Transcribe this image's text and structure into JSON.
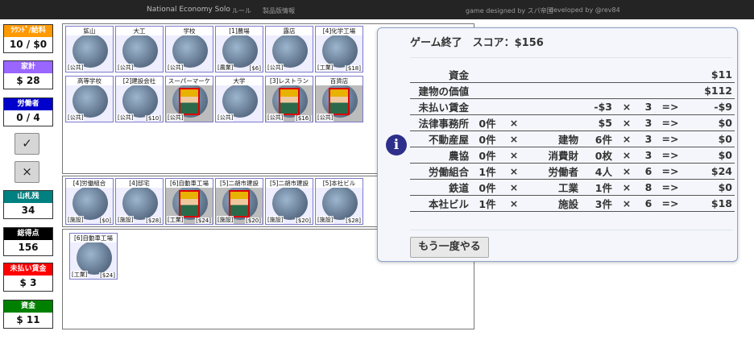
{
  "topbar": {
    "title": "National Economy Solo",
    "nav_rules": "ルール",
    "nav_cards": "製品版情報",
    "credit_design": "game designed by スパ帝国",
    "credit_dev": "developed by @rev84"
  },
  "stats": [
    {
      "label": "ﾗｳﾝﾄﾞ/給料",
      "value": "10 / $0",
      "color": "#ff9900"
    },
    {
      "label": "家計",
      "value": "$ 28",
      "color": "#9966ff"
    },
    {
      "label": "労働者",
      "value": "0 / 4",
      "color": "#0000cc"
    },
    {
      "label": "山札残",
      "value": "34",
      "color": "#008080"
    },
    {
      "label": "総得点",
      "value": "156",
      "color": "#000000"
    },
    {
      "label": "未払い賃金",
      "value": "$ 3",
      "color": "#ff0000"
    },
    {
      "label": "資金",
      "value": "$ 11",
      "color": "#008000"
    }
  ],
  "buttons": {
    "confirm": "✓",
    "cancel": "×"
  },
  "public_cards": [
    {
      "name": "鉱山",
      "cat": "[公共]",
      "cost": "",
      "worked": false
    },
    {
      "name": "大工",
      "cat": "[公共]",
      "cost": "",
      "worked": false
    },
    {
      "name": "学校",
      "cat": "[公共]",
      "cost": "",
      "worked": false
    },
    {
      "name": "[1]農場",
      "cat": "[農業]",
      "cost": "[$6]",
      "worked": false
    },
    {
      "name": "露店",
      "cat": "[公共]",
      "cost": "",
      "worked": false
    },
    {
      "name": "[4]化学工場",
      "cat": "[工業]",
      "cost": "[$18]",
      "worked": false
    },
    {
      "name": "高等学校",
      "cat": "[公共]",
      "cost": "",
      "worked": false
    },
    {
      "name": "[2]建設会社",
      "cat": "[公共]",
      "cost": "[$10]",
      "worked": false
    },
    {
      "name": "スーパーマーケ",
      "cat": "[公共]",
      "cost": "",
      "worked": true
    },
    {
      "name": "大学",
      "cat": "[公共]",
      "cost": "",
      "worked": false
    },
    {
      "name": "[3]レストラン",
      "cat": "[公共]",
      "cost": "[$16]",
      "worked": true
    },
    {
      "name": "百貨店",
      "cat": "[公共]",
      "cost": "",
      "worked": true
    }
  ],
  "owned_cards": [
    {
      "name": "[4]労働組合",
      "cat": "[施設]",
      "cost": "[$0]",
      "worked": false
    },
    {
      "name": "[4]邸宅",
      "cat": "[施設]",
      "cost": "[$28]",
      "worked": false
    },
    {
      "name": "[6]自動車工場",
      "cat": "[工業]",
      "cost": "[$24]",
      "worked": true
    },
    {
      "name": "[5]二胡市建設",
      "cat": "[施設]",
      "cost": "[$20]",
      "worked": true
    },
    {
      "name": "[5]二胡市建設",
      "cat": "[施設]",
      "cost": "[$20]",
      "worked": false
    },
    {
      "name": "[5]本社ビル",
      "cat": "[施設]",
      "cost": "[$28]",
      "worked": false
    }
  ],
  "hand_cards": [
    {
      "name": "[6]自動車工場",
      "cat": "[工業]",
      "cost": "[$24]",
      "worked": false
    }
  ],
  "modal": {
    "title": "ゲーム終了　スコア：$156",
    "replay_label": "もう一度やる",
    "rows": [
      [
        "資金",
        "",
        "",
        "",
        "",
        "",
        "",
        "",
        "$11"
      ],
      [
        "建物の価値",
        "",
        "",
        "",
        "",
        "",
        "",
        "",
        "$112"
      ],
      [
        "未払い賃金",
        "",
        "",
        "",
        "-$3",
        "×",
        "3",
        "=>",
        "-$9"
      ],
      [
        "法律事務所",
        "0件",
        "×",
        "",
        "$5",
        "×",
        "3",
        "=>",
        "$0"
      ],
      [
        "不動産屋",
        "0件",
        "×",
        "建物",
        "6件",
        "×",
        "3",
        "=>",
        "$0"
      ],
      [
        "農協",
        "0件",
        "×",
        "消費財",
        "0枚",
        "×",
        "3",
        "=>",
        "$0"
      ],
      [
        "労働組合",
        "1件",
        "×",
        "労働者",
        "4人",
        "×",
        "6",
        "=>",
        "$24"
      ],
      [
        "鉄道",
        "0件",
        "×",
        "工業",
        "1件",
        "×",
        "8",
        "=>",
        "$0"
      ],
      [
        "本社ビル",
        "1件",
        "×",
        "施設",
        "3件",
        "×",
        "6",
        "=>",
        "$18"
      ]
    ]
  }
}
